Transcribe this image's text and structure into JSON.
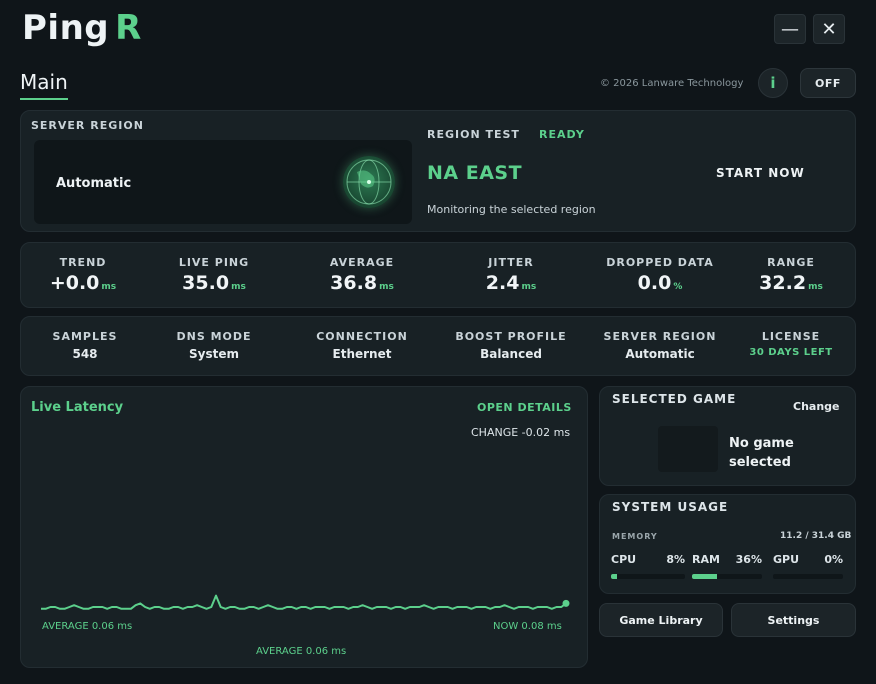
{
  "app": {
    "logo_main": "Ping",
    "logo_accent": "R",
    "minimize": "—",
    "close": "✕",
    "tab": "Main",
    "copyright": "© 2026 Lanware Technology",
    "info": "i",
    "power": "OFF"
  },
  "server_region": {
    "title": "SERVER REGION",
    "value": "Automatic",
    "globe_icon": "globe-icon"
  },
  "region_test": {
    "label": "REGION TEST",
    "status": "READY",
    "region": "NA EAST",
    "description": "Monitoring the selected region",
    "start": "START NOW"
  },
  "stats": [
    {
      "label": "TREND",
      "value": "+0.0",
      "unit": "ms"
    },
    {
      "label": "LIVE PING",
      "value": "35.0",
      "unit": "ms"
    },
    {
      "label": "AVERAGE",
      "value": "36.8",
      "unit": "ms"
    },
    {
      "label": "JITTER",
      "value": "2.4",
      "unit": "ms"
    },
    {
      "label": "DROPPED DATA",
      "value": "0.0",
      "unit": "%"
    },
    {
      "label": "RANGE",
      "value": "32.2",
      "unit": "ms"
    }
  ],
  "info": [
    {
      "label": "SAMPLES",
      "value": "548"
    },
    {
      "label": "DNS MODE",
      "value": "System"
    },
    {
      "label": "CONNECTION",
      "value": "Ethernet"
    },
    {
      "label": "BOOST PROFILE",
      "value": "Balanced"
    },
    {
      "label": "SERVER REGION",
      "value": "Automatic"
    },
    {
      "label": "LICENSE",
      "value": "30 DAYS LEFT"
    }
  ],
  "latency": {
    "title": "Live Latency",
    "open_details": "OPEN DETAILS",
    "change": "CHANGE -0.02 ms",
    "average_left": "AVERAGE 0.06 ms",
    "now_right": "NOW 0.08 ms",
    "average_bottom": "AVERAGE 0.06 ms",
    "line_color": "#5cd08c"
  },
  "chart_data": {
    "type": "line",
    "title": "Live Latency",
    "xlabel": "",
    "ylabel": "",
    "series": [
      {
        "values": [
          0.05,
          0.05,
          0.06,
          0.06,
          0.05,
          0.05,
          0.06,
          0.07,
          0.06,
          0.05,
          0.05,
          0.06,
          0.06,
          0.06,
          0.05,
          0.06,
          0.06,
          0.05,
          0.05,
          0.05,
          0.07,
          0.08,
          0.06,
          0.05,
          0.06,
          0.06,
          0.05,
          0.05,
          0.06,
          0.06,
          0.05,
          0.06,
          0.06,
          0.07,
          0.06,
          0.05,
          0.06,
          0.25,
          0.06,
          0.05,
          0.06,
          0.06,
          0.05,
          0.05,
          0.06,
          0.06,
          0.05,
          0.06,
          0.07,
          0.06,
          0.05,
          0.05,
          0.06,
          0.06,
          0.05,
          0.06,
          0.06,
          0.05,
          0.06,
          0.06,
          0.06,
          0.05,
          0.06,
          0.06,
          0.06,
          0.05,
          0.06,
          0.06,
          0.07,
          0.06,
          0.05,
          0.06,
          0.06,
          0.06,
          0.05,
          0.06,
          0.06,
          0.05,
          0.06,
          0.06,
          0.06,
          0.07,
          0.06,
          0.05,
          0.06,
          0.06,
          0.06,
          0.05,
          0.06,
          0.06,
          0.06,
          0.05,
          0.06,
          0.06,
          0.06,
          0.05,
          0.06,
          0.06,
          0.07,
          0.06,
          0.05,
          0.06,
          0.06,
          0.06,
          0.05,
          0.06,
          0.06,
          0.06,
          0.05,
          0.06,
          0.06,
          0.08
        ]
      }
    ],
    "ylim": [
      0,
      1
    ],
    "grid": false
  },
  "selected_game": {
    "title": "SELECTED GAME",
    "change": "Change",
    "empty": "No game selected"
  },
  "system_usage": {
    "title": "SYSTEM USAGE",
    "memory_label": "MEMORY",
    "memory_value": "11.2 / 31.4 GB",
    "items": [
      {
        "name": "CPU",
        "pct": "8%",
        "fraction": 0.08
      },
      {
        "name": "RAM",
        "pct": "36%",
        "fraction": 0.36
      },
      {
        "name": "GPU",
        "pct": "0%",
        "fraction": 0.0
      }
    ]
  },
  "buttons": {
    "library": "Game Library",
    "settings": "Settings"
  }
}
